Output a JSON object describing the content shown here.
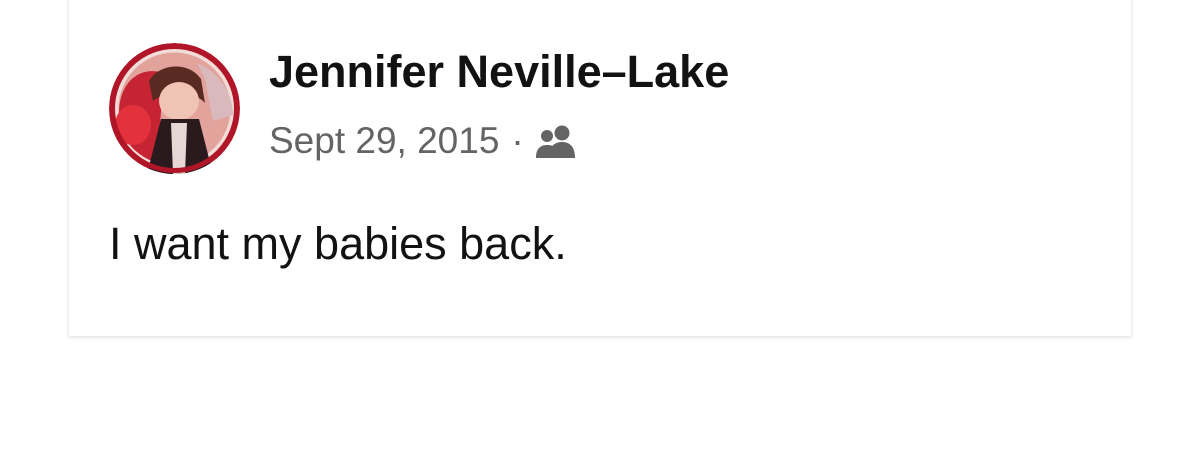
{
  "post": {
    "author_name": "Jennifer Neville–Lake",
    "date": "Sept 29, 2015",
    "separator": "·",
    "audience_icon": "friends-icon",
    "text": "I want my babies back."
  },
  "colors": {
    "name": "#121212",
    "meta": "#646464",
    "avatar_ring": "#c0182a"
  }
}
